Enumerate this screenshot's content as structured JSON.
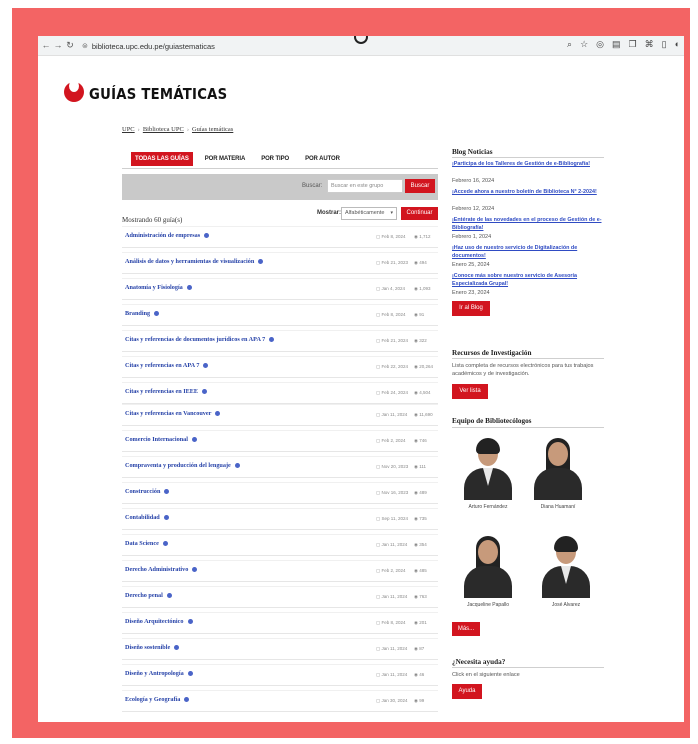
{
  "browser": {
    "url": "biblioteca.upc.edu.pe/guiastematicas",
    "back_icon": "arrow-left-icon",
    "forward_icon": "arrow-right-icon",
    "reload_icon": "reload-icon"
  },
  "header": {
    "logo_text": "GUÍAS TEMÁTICAS",
    "brand_color": "#d2151f"
  },
  "breadcrumb": [
    "UPC",
    "Biblioteca UPC",
    "Guías temáticas"
  ],
  "tabs": [
    "TODAS LAS GUÍAS",
    "POR MATERIA",
    "POR TIPO",
    "POR AUTOR"
  ],
  "search": {
    "label": "Buscar:",
    "placeholder": "Buscar en este grupo",
    "button": "Buscar"
  },
  "list": {
    "showing": "Mostrando 60 guía(s)",
    "sort_label": "Mostrar:",
    "sort_value": "Alfabéticamente",
    "continue_button": "Continuar",
    "guides": [
      {
        "title": "Administración de empresas",
        "date": "Feb 8, 2024",
        "views": "1,712"
      },
      {
        "title": "Análisis de datos y herramientas de visualización",
        "date": "Feb 21, 2023",
        "views": "494"
      },
      {
        "title": "Anatomía y Fisiología",
        "date": "Jan 4, 2024",
        "views": "1,093"
      },
      {
        "title": "Branding",
        "date": "Feb 8, 2024",
        "views": "91"
      },
      {
        "title": "Citas y referencias de documentos jurídicos en APA 7",
        "date": "Feb 21, 2024",
        "views": "322"
      },
      {
        "title": "Citas y referencias en APA 7",
        "date": "Feb 22, 2024",
        "views": "20,264"
      },
      {
        "title": "Citas y referencias en IEEE",
        "date": "Feb 24, 2024",
        "views": "4,504"
      },
      {
        "title": "Citas y referencias en Vancouver",
        "date": "Jan 11, 2024",
        "views": "11,690"
      },
      {
        "title": "Comercio Internacional",
        "date": "Feb 2, 2024",
        "views": "746"
      },
      {
        "title": "Compraventa y producción del lenguaje",
        "date": "Nov 20, 2023",
        "views": "111"
      },
      {
        "title": "Construcción",
        "date": "Nov 16, 2023",
        "views": "489"
      },
      {
        "title": "Contabilidad",
        "date": "Sep 11, 2024",
        "views": "735"
      },
      {
        "title": "Data Science",
        "date": "Jan 11, 2024",
        "views": "354"
      },
      {
        "title": "Derecho Administrativo",
        "date": "Feb 2, 2024",
        "views": "485"
      },
      {
        "title": "Derecho penal",
        "date": "Jan 11, 2024",
        "views": "763"
      },
      {
        "title": "Diseño Arquitectónico",
        "date": "Feb 8, 2024",
        "views": "201"
      },
      {
        "title": "Diseño sostenible",
        "date": "Jan 11, 2024",
        "views": "87"
      },
      {
        "title": "Diseño y Antropología",
        "date": "Jan 11, 2024",
        "views": "46"
      },
      {
        "title": "Ecología y Geografía",
        "date": "Jan 30, 2024",
        "views": "99"
      }
    ]
  },
  "sidebar": {
    "blog": {
      "title": "Blog Noticias",
      "items": [
        {
          "text": "¡Participa de los Talleres de Gestión de e-Bibliografía!",
          "date": "Febrero 16, 2024"
        },
        {
          "text": "¡Accede ahora a nuestro boletín de Biblioteca N° 2-2024!",
          "date": "Febrero 12, 2024"
        },
        {
          "text": "¡Entérate de las novedades en el proceso de Gestión de e-Bibliografía!",
          "date": "Febrero 1, 2024"
        },
        {
          "text": "¡Haz uso de nuestro servicio de Digitalización de documentos!",
          "date": "Enero 25, 2024"
        },
        {
          "text": "¡Conoce más sobre nuestro servicio de Asesoría Especializada Grupal!",
          "date": "Enero 23, 2024"
        }
      ],
      "button": "Ir al Blog"
    },
    "resources": {
      "title": "Recursos de Investigación",
      "text": "Lista completa de recursos electrónicos para tus trabajos académicos y de investigación.",
      "button": "Ver lista"
    },
    "team": {
      "title": "Equipo de Bibliotecólogos",
      "people": [
        "Arturo Fernández",
        "Diana Huamaní",
        "Jacqueline Papallo",
        "José Alvarez"
      ],
      "button": "Más..."
    },
    "help": {
      "title": "¿Necesita ayuda?",
      "text": "Click en el siguiente enlace",
      "button": "Ayuda"
    }
  }
}
